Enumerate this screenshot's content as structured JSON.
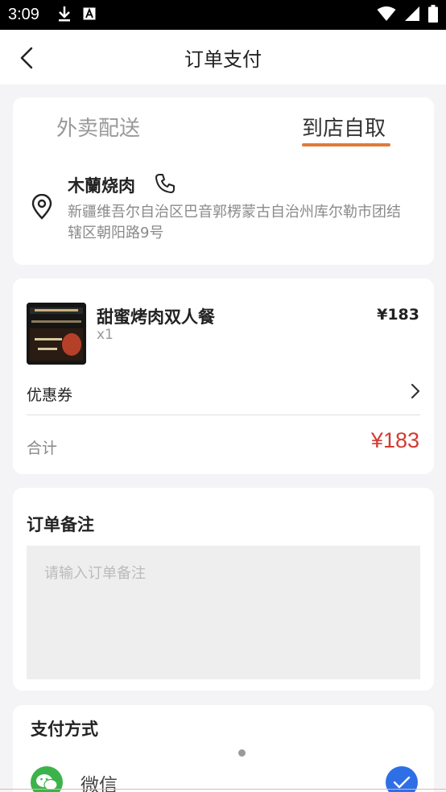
{
  "status_bar": {
    "time": "3:09"
  },
  "header": {
    "title": "订单支付"
  },
  "delivery": {
    "tabs": [
      {
        "label": "外卖配送"
      },
      {
        "label": "到店自取"
      }
    ],
    "active_tab": "到店自取",
    "store_name": "木蘭烧肉",
    "address": "新疆维吾尔自治区巴音郭楞蒙古自治州库尔勒市团结辖区朝阳路9号"
  },
  "order": {
    "product": {
      "name": "甜蜜烤肉双人餐",
      "qty": "x1",
      "price": "¥183"
    },
    "coupon_label": "优惠券",
    "total_label": "合计",
    "total_amount": "¥183"
  },
  "remark": {
    "title": "订单备注",
    "placeholder": "请输入订单备注",
    "value": ""
  },
  "payment": {
    "title": "支付方式",
    "methods": [
      {
        "label": "微信",
        "icon": "wechat-icon",
        "selected": true
      }
    ]
  },
  "colors": {
    "accent": "#e07a3a",
    "price_red": "#d23a32",
    "wechat_green": "#3cb34a",
    "check_blue": "#2f6fe6"
  }
}
